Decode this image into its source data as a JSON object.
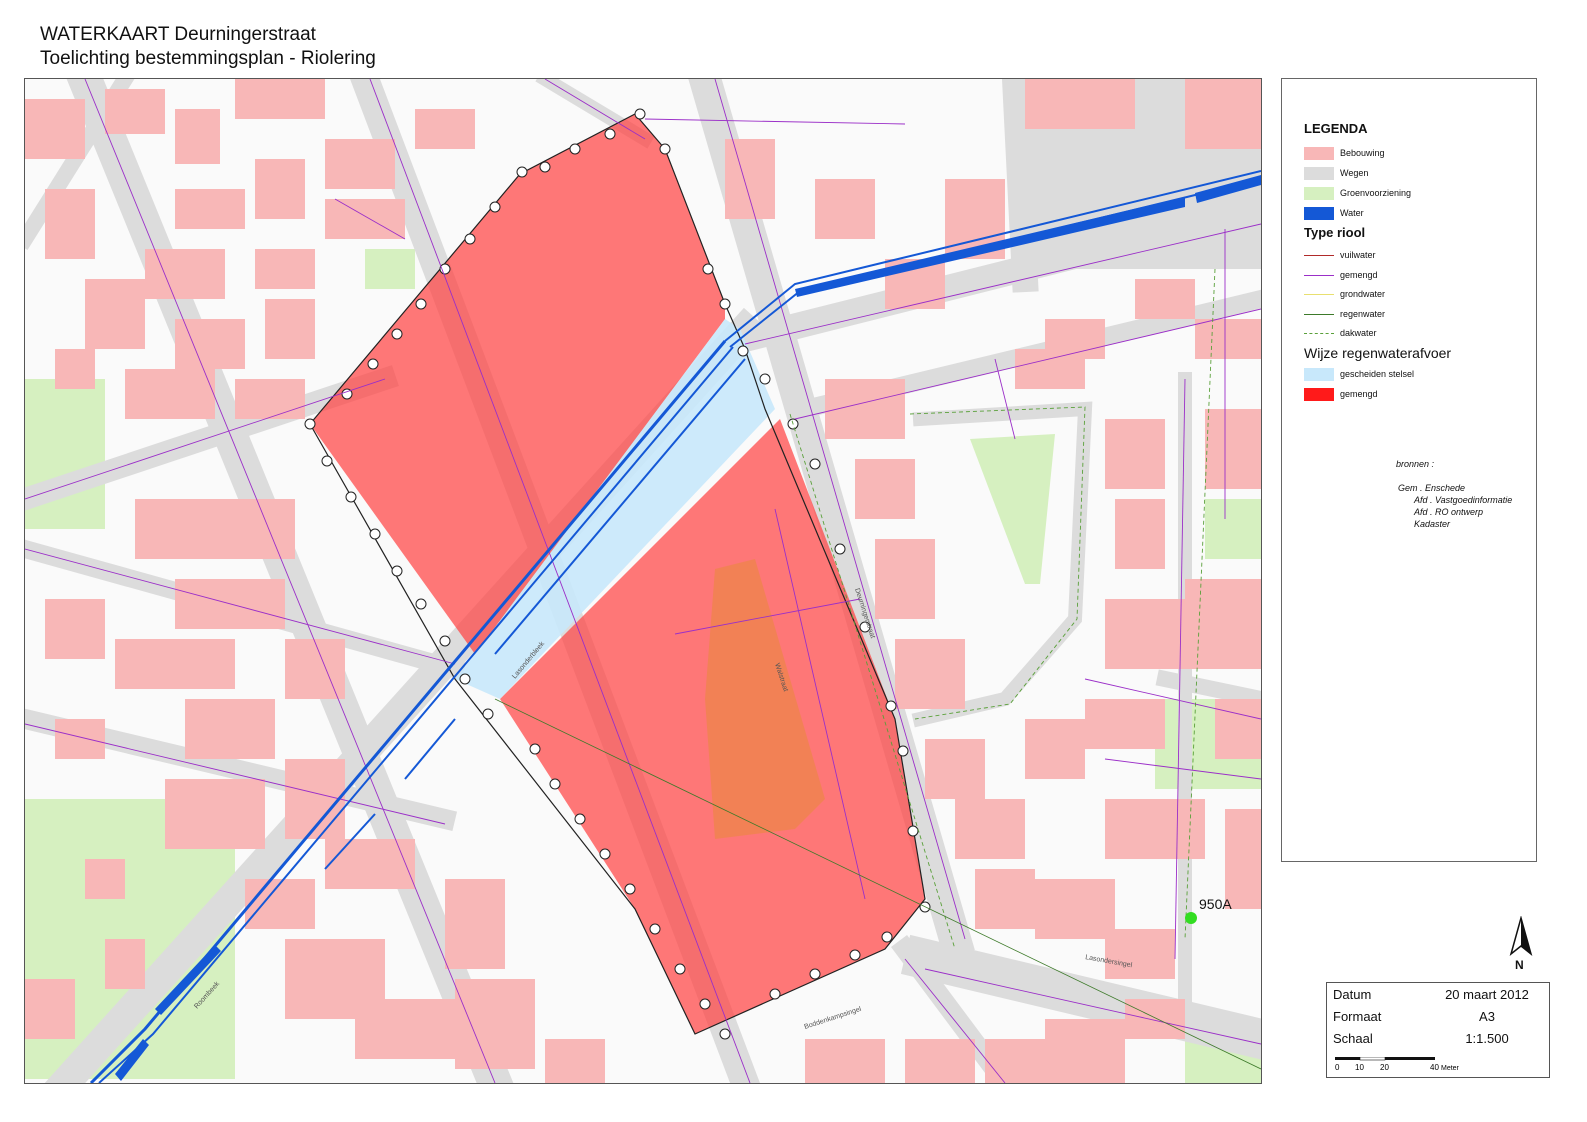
{
  "header": {
    "title": "WATERKAART Deurningerstraat",
    "subtitle": "Toelichting bestemmingsplan - Riolering"
  },
  "legend": {
    "heading": "LEGENDA",
    "land_use": [
      {
        "label": "Bebouwing",
        "color": "#f8b7b7"
      },
      {
        "label": "Wegen",
        "color": "#dcdcdc"
      },
      {
        "label": "Groenvoorziening",
        "color": "#d6f0c0"
      },
      {
        "label": "Water",
        "color": "#1458d6"
      }
    ],
    "sewer_heading": "Type riool",
    "sewer_types": [
      {
        "label": "vuilwater",
        "color": "#b02a2a",
        "style": "solid"
      },
      {
        "label": "gemengd",
        "color": "#9b2fc8",
        "style": "solid"
      },
      {
        "label": "grondwater",
        "color": "#e8e070",
        "style": "solid"
      },
      {
        "label": "regenwater",
        "color": "#3d7a2a",
        "style": "solid"
      },
      {
        "label": "dakwater",
        "color": "#5aa03a",
        "style": "dashed"
      }
    ],
    "drainage_heading": "Wijze regenwaterafvoer",
    "drainage_types": [
      {
        "label": "gescheiden stelsel",
        "color": "#c8e8fb"
      },
      {
        "label": "gemengd",
        "color": "#ff1a1a"
      }
    ],
    "sources_heading": "bronnen :",
    "sources": [
      "Gem . Enschede",
      "Afd . Vastgoedinformatie",
      "Afd . RO ontwerp",
      "Kadaster"
    ]
  },
  "map": {
    "colors": {
      "background": "#fafafa",
      "building": "#f8b7b7",
      "road": "#dcdcdc",
      "green": "#d6f0c0",
      "water": "#1458d6",
      "combined_area": "#ff4444",
      "separate_area": "#c8e8fb",
      "sewer_combined": "#9b2fc8"
    },
    "point_label": "950A",
    "point_color": "#33dd22",
    "street_labels": [
      "Roombeek",
      "Lasonderbleek",
      "Lasondersingel",
      "Boddenkampsingel",
      "Deurningerstraat",
      "Walstraat"
    ]
  },
  "info": {
    "datum_label": "Datum",
    "datum_value": "20 maart 2012",
    "formaat_label": "Formaat",
    "formaat_value": "A3",
    "schaal_label": "Schaal",
    "schaal_value": "1:1.500",
    "scale_ticks": [
      "0",
      "10",
      "20",
      "40"
    ],
    "scale_unit": "Meter"
  },
  "north_arrow": {
    "label": "N"
  }
}
